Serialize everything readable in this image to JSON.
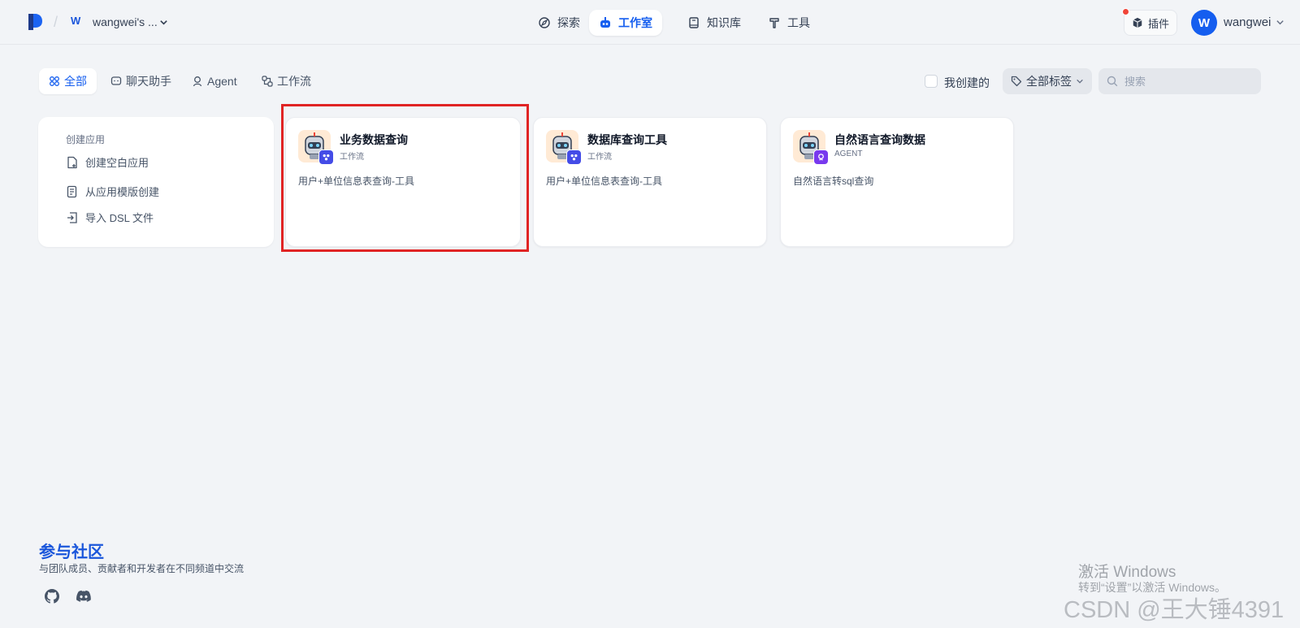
{
  "header": {
    "workspace_initial": "W",
    "workspace_name": "wangwei's ...",
    "nav": [
      {
        "label": "探索",
        "icon": "explore-icon"
      },
      {
        "label": "工作室",
        "icon": "robot-icon"
      },
      {
        "label": "知识库",
        "icon": "book-icon"
      },
      {
        "label": "工具",
        "icon": "hammer-icon"
      }
    ],
    "plugin_label": "插件",
    "avatar_initial": "W",
    "user_name": "wangwei"
  },
  "filters": {
    "tabs": [
      {
        "label": "全部",
        "icon": "grid-icon"
      },
      {
        "label": "聊天助手",
        "icon": "chat-icon"
      },
      {
        "label": "Agent",
        "icon": "agent-icon"
      },
      {
        "label": "工作流",
        "icon": "workflow-icon"
      }
    ],
    "mine_label": "我创建的",
    "tag_label": "全部标签",
    "search_placeholder": "搜索"
  },
  "create": {
    "title": "创建应用",
    "items": [
      "创建空白应用",
      "从应用模版创建",
      "导入 DSL 文件"
    ]
  },
  "apps": [
    {
      "name": "业务数据查询",
      "type": "工作流",
      "desc": "用户+单位信息表查询-工具",
      "badge_color": "#444ce7"
    },
    {
      "name": "数据库查询工具",
      "type": "工作流",
      "desc": "用户+单位信息表查询-工具",
      "badge_color": "#444ce7"
    },
    {
      "name": "自然语言查询数据",
      "type": "AGENT",
      "desc": "自然语言转sql查询",
      "badge_color": "#7839ee"
    }
  ],
  "community": {
    "title": "参与社区",
    "desc": "与团队成员、贡献者和开发者在不同频道中交流"
  },
  "watermark": {
    "line1": "激活 Windows",
    "line2": "转到“设置”以激活 Windows。",
    "csdn": "CSDN @王大锤4391"
  },
  "colors": {
    "accent": "#155eef",
    "highlight": "#e02424"
  }
}
